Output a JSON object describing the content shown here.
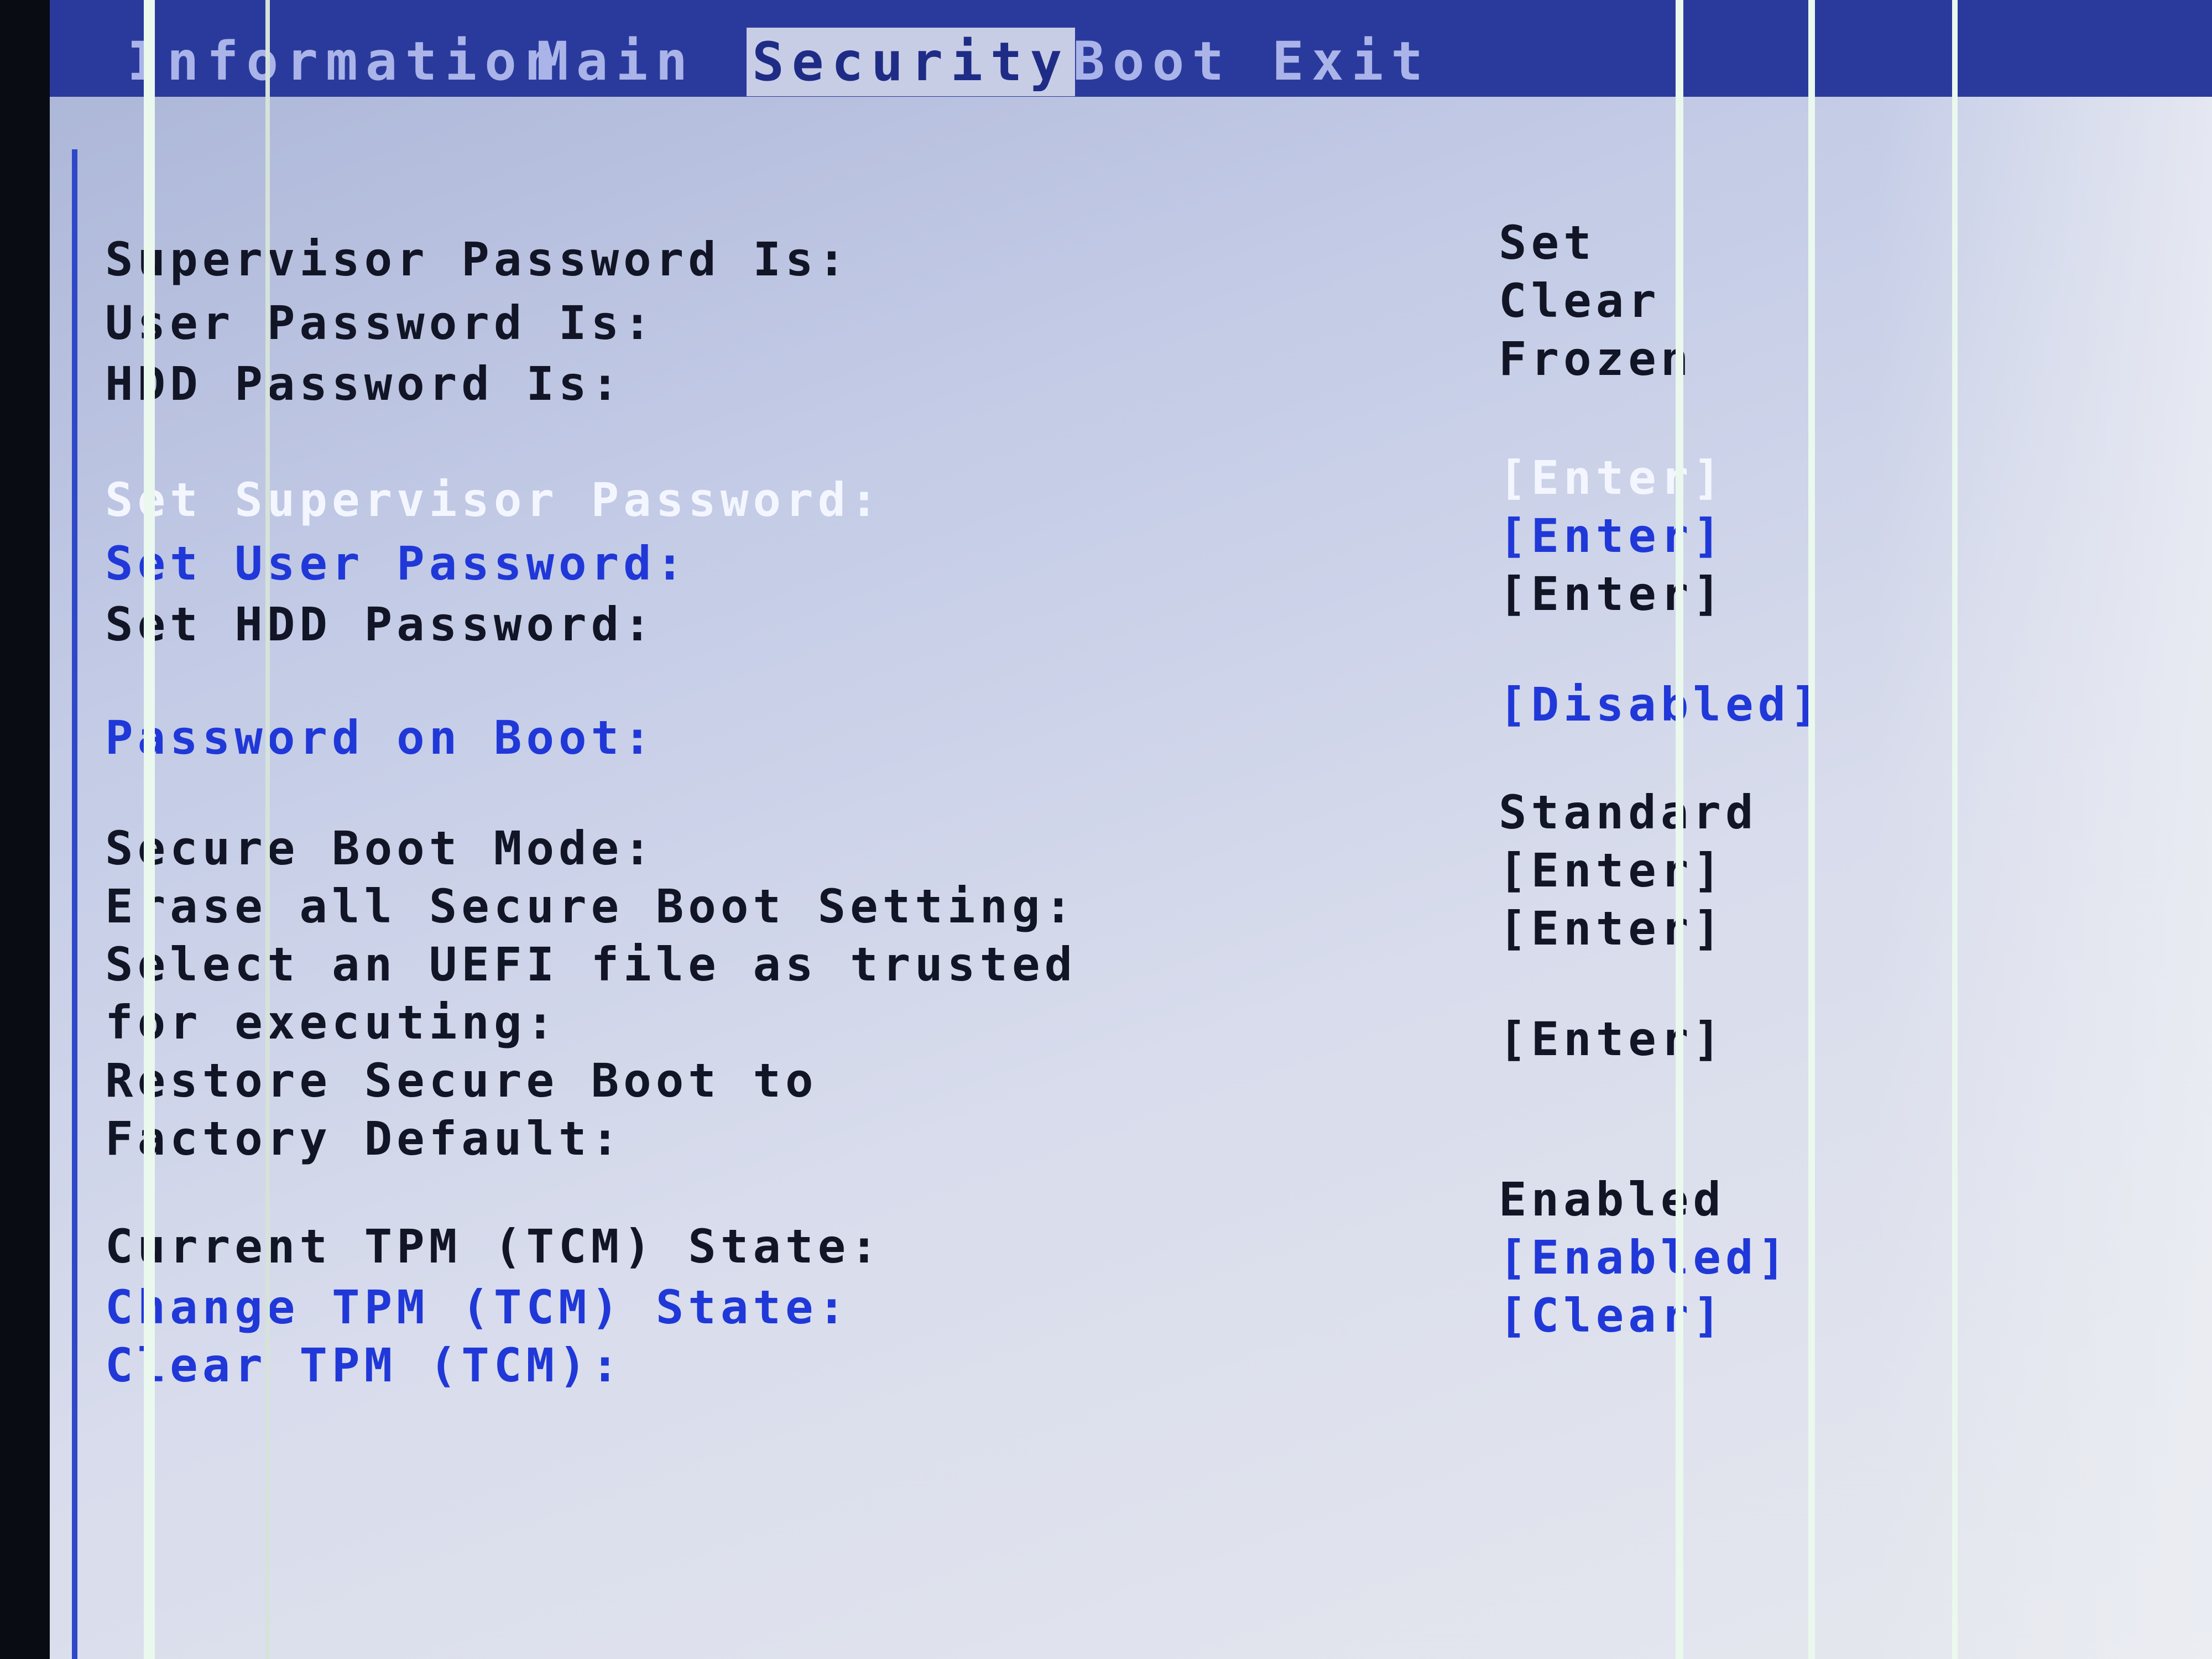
{
  "menu": {
    "items": [
      "Information",
      "Main",
      "Security",
      "Boot",
      "Exit"
    ],
    "active": "Security"
  },
  "status": {
    "supervisor_label": "Supervisor Password Is:",
    "supervisor_value": "Set",
    "user_label": "User Password Is:",
    "user_value": "Clear",
    "hdd_label": "HDD Password Is:",
    "hdd_value": "Frozen"
  },
  "passwords": {
    "set_supervisor_label": "Set Supervisor Password:",
    "set_supervisor_value": "[Enter]",
    "set_user_label": "Set User Password:",
    "set_user_value": "[Enter]",
    "set_hdd_label": "Set HDD Password:",
    "set_hdd_value": "[Enter]",
    "boot_label": "Password on Boot:",
    "boot_value": "[Disabled]"
  },
  "secure_boot": {
    "mode_label": "Secure Boot Mode:",
    "mode_value": "Standard",
    "erase_label": "Erase all Secure Boot Setting:",
    "erase_value": "[Enter]",
    "select_label_line1": "Select an UEFI file as trusted",
    "select_label_line2": "for executing:",
    "select_value": "[Enter]",
    "restore_label_line1": "Restore Secure Boot to",
    "restore_label_line2": "Factory Default:",
    "restore_value": "[Enter]"
  },
  "tpm": {
    "current_label": "Current TPM (TCM) State:",
    "current_value": "Enabled",
    "change_label": "Change TPM (TCM) State:",
    "change_value": "[Enabled]",
    "clear_label": "Clear TPM (TCM):",
    "clear_value": "[Clear]"
  },
  "colors": {
    "menubar": "#2a3a9c",
    "highlight": "#2038d8",
    "text": "#121526",
    "selected_text": "#f4f6ff"
  }
}
